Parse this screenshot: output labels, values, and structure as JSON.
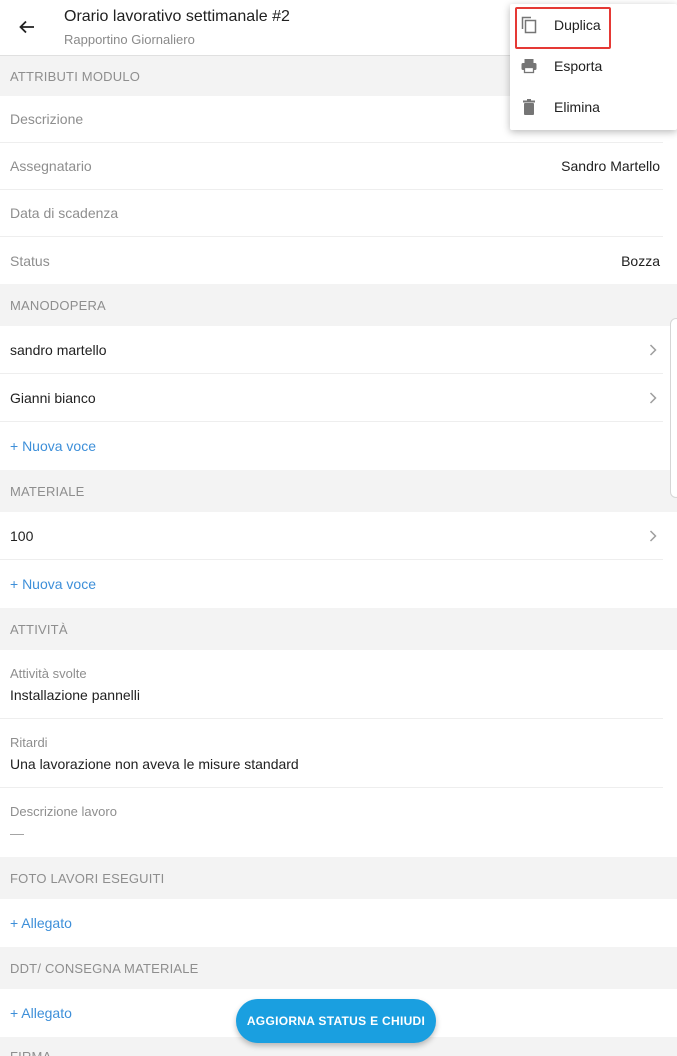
{
  "header": {
    "title": "Orario lavorativo settimanale #2",
    "subtitle": "Rapportino Giornaliero"
  },
  "menu": {
    "items": [
      {
        "label": "Duplica",
        "icon": "copy-icon"
      },
      {
        "label": "Esporta",
        "icon": "print-icon"
      },
      {
        "label": "Elimina",
        "icon": "trash-icon"
      }
    ]
  },
  "sections": {
    "attributi": {
      "title": "ATTRIBUTI MODULO",
      "rows": [
        {
          "label": "Descrizione",
          "value": ""
        },
        {
          "label": "Assegnatario",
          "value": "Sandro Martello"
        },
        {
          "label": "Data di scadenza",
          "value": ""
        },
        {
          "label": "Status",
          "value": "Bozza"
        }
      ]
    },
    "manodopera": {
      "title": "MANODOPERA",
      "items": [
        "sandro martello",
        "Gianni bianco"
      ],
      "add_label": "+ Nuova voce"
    },
    "materiale": {
      "title": "MATERIALE",
      "items": [
        "100"
      ],
      "add_label": "+ Nuova voce"
    },
    "attivita": {
      "title": "ATTIVITÀ",
      "fields": [
        {
          "label": "Attività svolte",
          "value": "Installazione pannelli"
        },
        {
          "label": "Ritardi",
          "value": "Una lavorazione non aveva le misure standard"
        },
        {
          "label": "Descrizione lavoro",
          "value": "—"
        }
      ]
    },
    "foto": {
      "title": "FOTO LAVORI ESEGUITI",
      "add_label": "+ Allegato"
    },
    "ddt": {
      "title": "DDT/ CONSEGNA MATERIALE",
      "add_label": "+ Allegato"
    },
    "firma": {
      "title": "FIRMA"
    }
  },
  "fab": {
    "label": "AGGIORNA STATUS E CHIUDI"
  },
  "colors": {
    "accent": "#1a9fe0",
    "link": "#3d8fd9",
    "highlight": "#e53935"
  }
}
